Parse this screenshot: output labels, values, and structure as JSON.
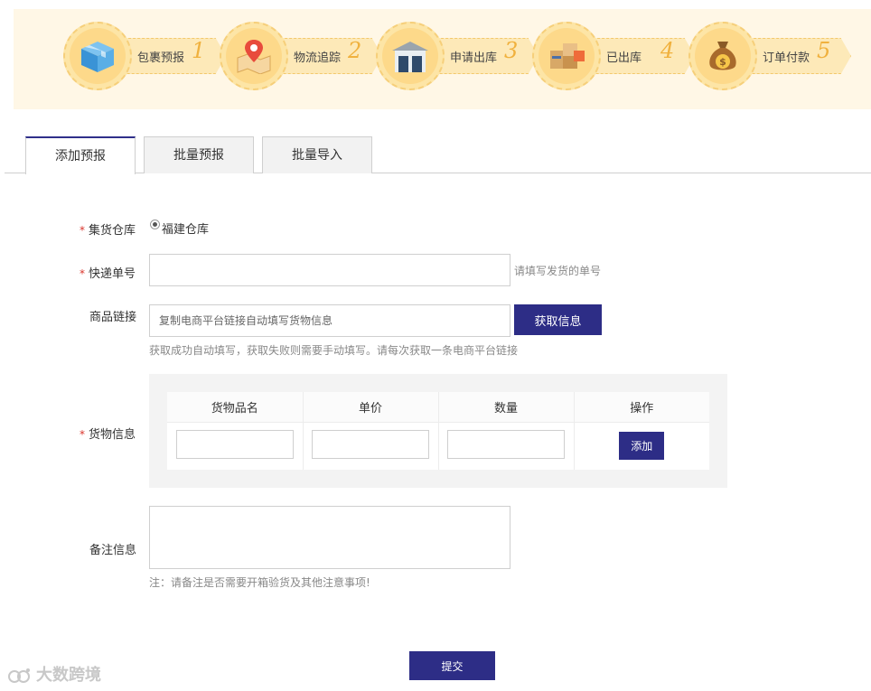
{
  "steps": [
    {
      "label": "包裹预报",
      "num": "1",
      "icon": "package-box-icon"
    },
    {
      "label": "物流追踪",
      "num": "2",
      "icon": "map-pin-icon"
    },
    {
      "label": "申请出库",
      "num": "3",
      "icon": "warehouse-icon"
    },
    {
      "label": "已出库",
      "num": "4",
      "icon": "shipped-boxes-icon"
    },
    {
      "label": "订单付款",
      "num": "5",
      "icon": "money-bag-icon"
    }
  ],
  "tabs": [
    "添加预报",
    "批量预报",
    "批量导入"
  ],
  "form": {
    "required_mark": "*",
    "warehouse": {
      "label": "集货仓库",
      "option": "福建仓库"
    },
    "tracking": {
      "label": "快递单号",
      "value": "",
      "hint": "请填写发货的单号"
    },
    "link": {
      "label": "商品链接",
      "placeholder": "复制电商平台链接自动填写货物信息",
      "button": "获取信息",
      "hint": "获取成功自动填写，获取失败则需要手动填写。请每次获取一条电商平台链接"
    },
    "goods": {
      "label": "货物信息",
      "columns": [
        "货物品名",
        "单价",
        "数量",
        "操作"
      ],
      "add_button": "添加"
    },
    "remarks": {
      "label": "备注信息",
      "hint": "注：请备注是否需要开箱验货及其他注意事项!"
    },
    "submit": "提交"
  },
  "watermark": "大数跨境",
  "colors": {
    "accent": "#2d2d86",
    "banner_bg": "#fff7e6",
    "step_gold": "#f0b13e",
    "required": "#d9342b"
  }
}
